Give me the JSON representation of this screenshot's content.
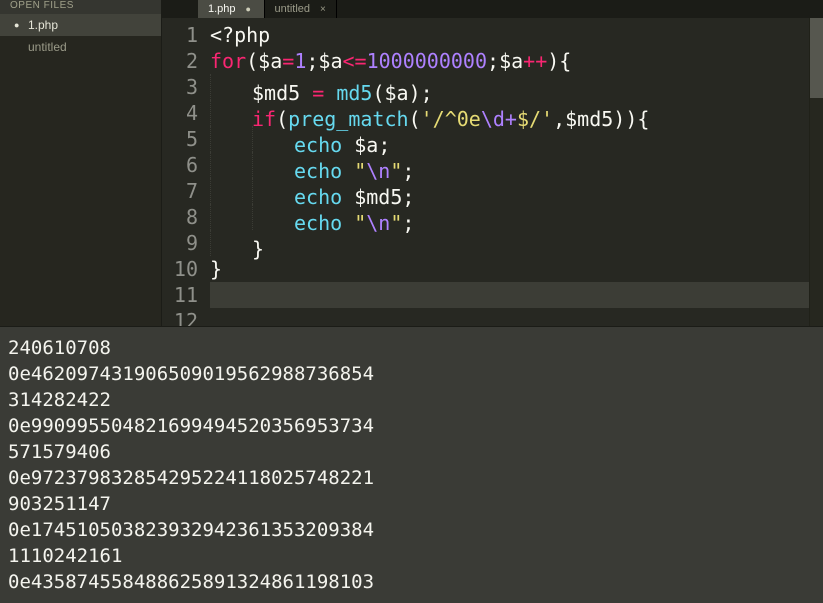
{
  "sidebar": {
    "header": "OPEN FILES",
    "items": [
      {
        "label": "1.php",
        "modified": true,
        "active": true
      },
      {
        "label": "untitled",
        "modified": false,
        "active": false
      }
    ]
  },
  "tabs": [
    {
      "label": "1.php",
      "active": true,
      "modified": true
    },
    {
      "label": "untitled",
      "active": false,
      "modified": false
    }
  ],
  "code": {
    "lines": [
      {
        "segments": [
          {
            "t": "<?php",
            "c": "tk-punc"
          }
        ]
      },
      {
        "segments": [
          {
            "t": "for",
            "c": "tk-keyword"
          },
          {
            "t": "(",
            "c": "tk-punc"
          },
          {
            "t": "$a",
            "c": "tk-var"
          },
          {
            "t": "=",
            "c": "tk-op"
          },
          {
            "t": "1",
            "c": "tk-num"
          },
          {
            "t": ";",
            "c": "tk-punc"
          },
          {
            "t": "$a",
            "c": "tk-var"
          },
          {
            "t": "<=",
            "c": "tk-op"
          },
          {
            "t": "1000000000",
            "c": "tk-num"
          },
          {
            "t": ";",
            "c": "tk-punc"
          },
          {
            "t": "$a",
            "c": "tk-var"
          },
          {
            "t": "++",
            "c": "tk-op"
          },
          {
            "t": "){",
            "c": "tk-punc"
          }
        ]
      },
      {
        "indent": 1,
        "segments": [
          {
            "t": "$md5",
            "c": "tk-var"
          },
          {
            "t": " ",
            "c": "tk-punc"
          },
          {
            "t": "=",
            "c": "tk-op"
          },
          {
            "t": " ",
            "c": "tk-punc"
          },
          {
            "t": "md5",
            "c": "tk-func"
          },
          {
            "t": "(",
            "c": "tk-punc"
          },
          {
            "t": "$a",
            "c": "tk-var"
          },
          {
            "t": ");",
            "c": "tk-punc"
          }
        ]
      },
      {
        "indent": 1,
        "segments": [
          {
            "t": "if",
            "c": "tk-keyword"
          },
          {
            "t": "(",
            "c": "tk-punc"
          },
          {
            "t": "preg_match",
            "c": "tk-func"
          },
          {
            "t": "(",
            "c": "tk-punc"
          },
          {
            "t": "'/^0e",
            "c": "tk-str"
          },
          {
            "t": "\\d+",
            "c": "tk-esc"
          },
          {
            "t": "$/'",
            "c": "tk-str"
          },
          {
            "t": ",",
            "c": "tk-punc"
          },
          {
            "t": "$md5",
            "c": "tk-var"
          },
          {
            "t": ")){",
            "c": "tk-punc"
          }
        ]
      },
      {
        "indent": 2,
        "segments": [
          {
            "t": "echo",
            "c": "tk-func"
          },
          {
            "t": " ",
            "c": "tk-punc"
          },
          {
            "t": "$a",
            "c": "tk-var"
          },
          {
            "t": ";",
            "c": "tk-punc"
          }
        ]
      },
      {
        "indent": 2,
        "segments": [
          {
            "t": "echo",
            "c": "tk-func"
          },
          {
            "t": " ",
            "c": "tk-punc"
          },
          {
            "t": "\"",
            "c": "tk-str"
          },
          {
            "t": "\\n",
            "c": "tk-esc"
          },
          {
            "t": "\"",
            "c": "tk-str"
          },
          {
            "t": ";",
            "c": "tk-punc"
          }
        ]
      },
      {
        "indent": 2,
        "segments": [
          {
            "t": "echo",
            "c": "tk-func"
          },
          {
            "t": " ",
            "c": "tk-punc"
          },
          {
            "t": "$md5",
            "c": "tk-var"
          },
          {
            "t": ";",
            "c": "tk-punc"
          }
        ]
      },
      {
        "indent": 2,
        "segments": [
          {
            "t": "echo",
            "c": "tk-func"
          },
          {
            "t": " ",
            "c": "tk-punc"
          },
          {
            "t": "\"",
            "c": "tk-str"
          },
          {
            "t": "\\n",
            "c": "tk-esc"
          },
          {
            "t": "\"",
            "c": "tk-str"
          },
          {
            "t": ";",
            "c": "tk-punc"
          }
        ]
      },
      {
        "indent": 1,
        "segments": [
          {
            "t": "}",
            "c": "tk-punc"
          }
        ]
      },
      {
        "segments": [
          {
            "t": "}",
            "c": "tk-punc"
          }
        ]
      },
      {
        "highlight": true,
        "segments": []
      },
      {
        "partial": true,
        "segments": []
      }
    ]
  },
  "console": {
    "output": [
      "240610708",
      "0e462097431906509019562988736854",
      "314282422",
      "0e990995504821699494520356953734",
      "571579406",
      "0e972379832854295224118025748221",
      "903251147",
      "0e174510503823932942361353209384",
      "1110242161",
      "0e435874558488625891324861198103"
    ]
  }
}
